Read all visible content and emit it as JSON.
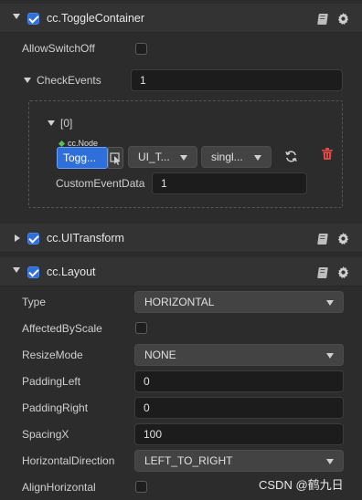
{
  "toggle_container": {
    "title": "cc.ToggleContainer",
    "expanded": true,
    "enabled": true,
    "allow_switch_off_label": "AllowSwitchOff",
    "allow_switch_off": false,
    "check_events_label": "CheckEvents",
    "check_events_count": "1",
    "events": [
      {
        "index_label": "[0]",
        "node_tag": "cc.Node",
        "target_node": "Togg...",
        "component": "UI_T...",
        "handler": "singl...",
        "custom_event_data_label": "CustomEventData",
        "custom_event_data": "1"
      }
    ]
  },
  "ui_transform": {
    "title": "cc.UITransform",
    "expanded": false,
    "enabled": true
  },
  "layout": {
    "title": "cc.Layout",
    "expanded": true,
    "enabled": true,
    "fields": {
      "type": {
        "label": "Type",
        "value": "HORIZONTAL"
      },
      "affected_by_scale": {
        "label": "AffectedByScale",
        "value": false
      },
      "resize_mode": {
        "label": "ResizeMode",
        "value": "NONE"
      },
      "padding_left": {
        "label": "PaddingLeft",
        "value": "0"
      },
      "padding_right": {
        "label": "PaddingRight",
        "value": "0"
      },
      "spacing_x": {
        "label": "SpacingX",
        "value": "100"
      },
      "horizontal_direction": {
        "label": "HorizontalDirection",
        "value": "LEFT_TO_RIGHT"
      },
      "align_horizontal": {
        "label": "AlignHorizontal",
        "value": false
      }
    }
  },
  "icons": {
    "help": "book-icon",
    "settings": "gear-icon",
    "reset": "refresh-icon",
    "remove": "trash-icon"
  },
  "colors": {
    "accent": "#2f6fd9",
    "delete": "#e04848",
    "panel_bg": "#2c2c2c"
  },
  "watermark": "CSDN @鹤九日"
}
